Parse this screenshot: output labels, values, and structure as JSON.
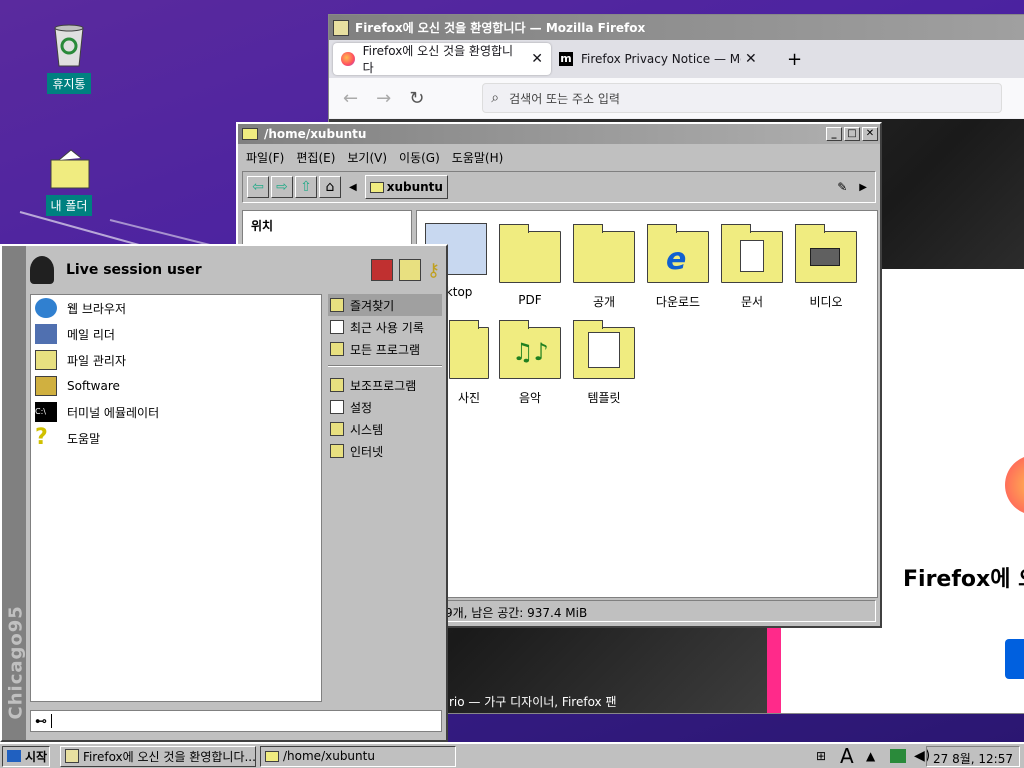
{
  "desktop": {
    "icons": [
      {
        "label": "휴지통"
      },
      {
        "label": "내 폴더"
      }
    ]
  },
  "firefox": {
    "title": "Firefox에 오신 것을 환영합니다 — Mozilla Firefox",
    "tabs": [
      {
        "label": "Firefox에 오신 것을 환영합니다"
      },
      {
        "label": "Firefox Privacy Notice — Mozi"
      }
    ],
    "new_tab": "+",
    "url_placeholder": "검색어 또는 주소 입력",
    "page_heading": "Firefox에 오",
    "caption": "rio — 가구 디자이너, Firefox 팬"
  },
  "thunar": {
    "title": "/home/xubuntu",
    "menu": [
      "파일(F)",
      "편집(E)",
      "보기(V)",
      "이동(G)",
      "도움말(H)"
    ],
    "path": "xubuntu",
    "side_heading": "위치",
    "items": [
      {
        "label": "sktop"
      },
      {
        "label": "PDF"
      },
      {
        "label": "공개"
      },
      {
        "label": "다운로드"
      },
      {
        "label": "문서"
      },
      {
        "label": "비디오"
      },
      {
        "label": "사진"
      },
      {
        "label": "음악"
      },
      {
        "label": "템플릿"
      }
    ],
    "status": "9개, 남은 공간: 937.4 MiB"
  },
  "startmenu": {
    "brand": "Chicago95",
    "user": "Live session user",
    "left_items": [
      {
        "label": "웹 브라우저"
      },
      {
        "label": "메일 리더"
      },
      {
        "label": "파일 관리자"
      },
      {
        "label": "Software"
      },
      {
        "label": "터미널 에뮬레이터"
      },
      {
        "label": "도움말"
      }
    ],
    "right_items": [
      {
        "label": "즐겨찾기"
      },
      {
        "label": "최근 사용 기록"
      },
      {
        "label": "모든 프로그램"
      },
      {
        "label": "보조프로그램"
      },
      {
        "label": "설정"
      },
      {
        "label": "시스템"
      },
      {
        "label": "인터넷"
      }
    ]
  },
  "taskbar": {
    "start": "시작",
    "tasks": [
      {
        "label": "Firefox에 오신 것을 환영합니다..."
      },
      {
        "label": "/home/xubuntu"
      }
    ],
    "clock": "27 8월, 12:57"
  }
}
